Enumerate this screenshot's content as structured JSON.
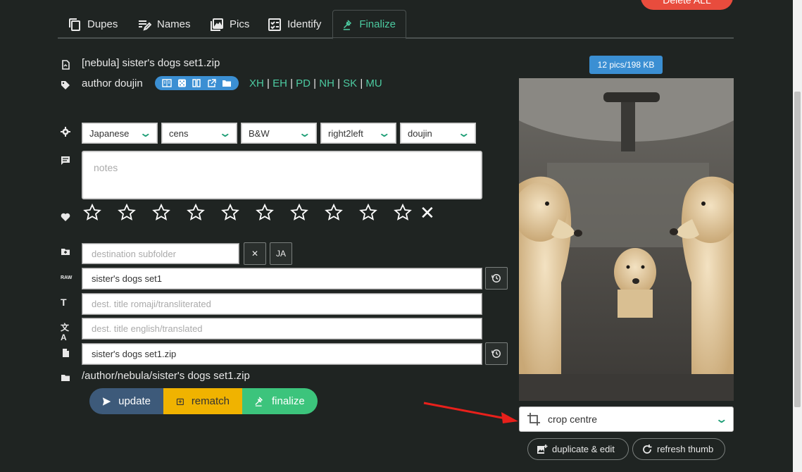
{
  "delete_button": {
    "label": "Delete ALL"
  },
  "tabs": [
    {
      "label": "Dupes",
      "icon": "copy-icon"
    },
    {
      "label": "Names",
      "icon": "rename-icon"
    },
    {
      "label": "Pics",
      "icon": "images-icon"
    },
    {
      "label": "Identify",
      "icon": "checklist-icon"
    },
    {
      "label": "Finalize",
      "icon": "gavel-icon",
      "active": true
    }
  ],
  "file": {
    "name": "[nebula] sister's dogs set1.zip",
    "tags": "author doujin",
    "link_sites": [
      "XH",
      "EH",
      "PD",
      "NH",
      "SK",
      "MU"
    ],
    "path": "/author/nebula/sister's dogs set1.zip"
  },
  "selects": [
    {
      "value": "Japanese"
    },
    {
      "value": "cens"
    },
    {
      "value": "B&W"
    },
    {
      "value": "right2left"
    },
    {
      "value": "doujin"
    }
  ],
  "notes": {
    "placeholder": "notes"
  },
  "rating": {
    "count": 10,
    "value": 0,
    "clear_label": "✕"
  },
  "fields": {
    "subfolder_placeholder": "destination subfolder",
    "raw_title": "sister's dogs set1",
    "romaji_placeholder": "dest. title romaji/transliterated",
    "english_placeholder": "dest. title english/translated",
    "filename": "sister's dogs set1.zip",
    "clear_btn": "✕",
    "ja_btn": "JA"
  },
  "actions": {
    "update": "update",
    "rematch": "rematch",
    "finalize": "finalize"
  },
  "preview": {
    "badge": "12 pics/198 KB",
    "crop_value": "crop centre",
    "duplicate_edit": "duplicate & edit",
    "refresh_thumb": "refresh thumb"
  },
  "colors": {
    "accent": "#4ccaa0",
    "update": "#3d5a7a",
    "rematch": "#f0b300",
    "finalize": "#3cc47c",
    "badge": "#3b8fd3",
    "danger": "#e84c3d"
  }
}
